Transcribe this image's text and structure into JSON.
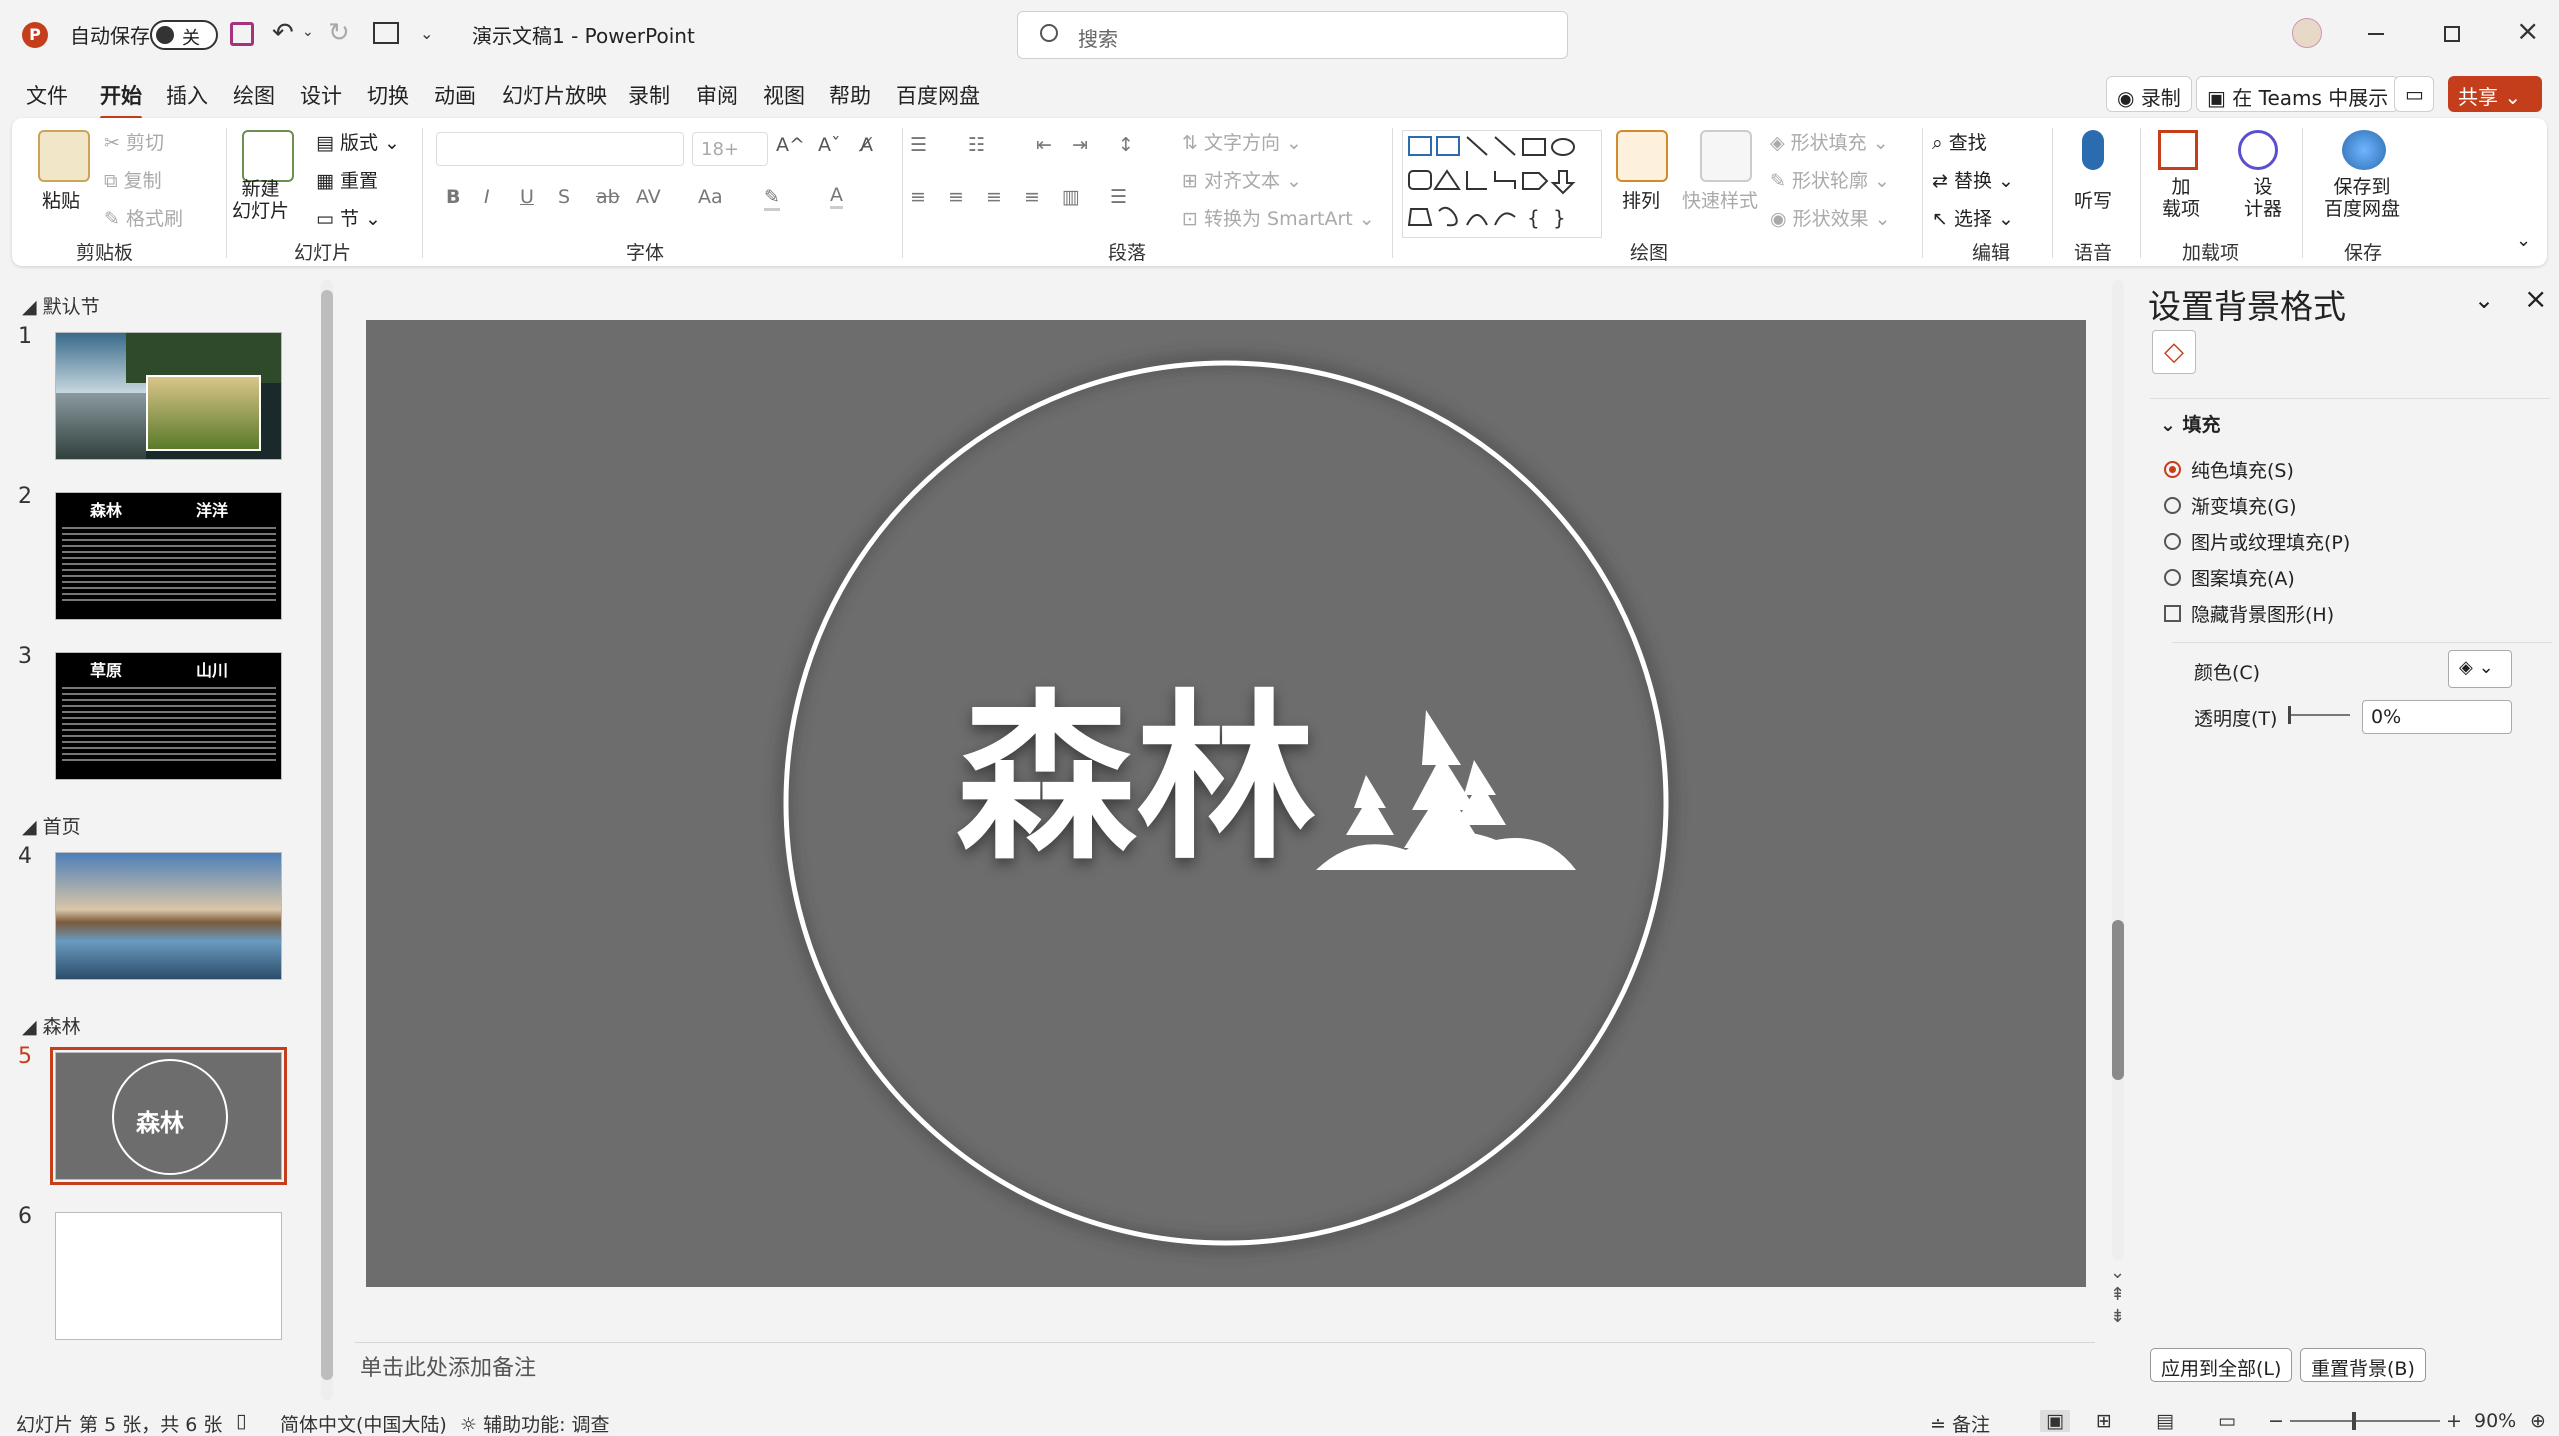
{
  "titlebar": {
    "autosave_label": "自动保存",
    "autosave_state": "关",
    "doc_title": "演示文稿1  -  PowerPoint",
    "search_placeholder": "搜索"
  },
  "tabs": [
    "文件",
    "开始",
    "插入",
    "绘图",
    "设计",
    "切换",
    "动画",
    "幻灯片放映",
    "录制",
    "审阅",
    "视图",
    "帮助",
    "百度网盘"
  ],
  "active_tab": "开始",
  "ribbon_right": {
    "record": "录制",
    "teams": "在 Teams 中展示",
    "share": "共享"
  },
  "groups": {
    "clipboard": {
      "label": "剪贴板",
      "paste": "粘贴",
      "cut": "剪切",
      "copy": "复制",
      "format_painter": "格式刷"
    },
    "slides": {
      "label": "幻灯片",
      "new_slide": "新建\n幻灯片",
      "layout": "版式",
      "reset": "重置",
      "section": "节"
    },
    "font": {
      "label": "字体",
      "font_size": "18+"
    },
    "paragraph": {
      "label": "段落",
      "text_direction": "文字方向",
      "align_text": "对齐文本",
      "smartart": "转换为 SmartArt"
    },
    "drawing": {
      "label": "绘图",
      "arrange": "排列",
      "quick_styles": "快速样式",
      "shape_fill": "形状填充",
      "shape_outline": "形状轮廓",
      "shape_effects": "形状效果"
    },
    "editing": {
      "label": "编辑",
      "find": "查找",
      "replace": "替换",
      "select": "选择"
    },
    "voice": {
      "label": "语音",
      "dictate": "听写"
    },
    "addins": {
      "label": "加载项",
      "addins": "加\n载项",
      "designer": "设\n计器"
    },
    "save": {
      "label": "保存",
      "save_baidu": "保存到\n百度网盘"
    }
  },
  "thumbnails": {
    "sections": [
      "默认节",
      "首页",
      "森林"
    ],
    "slides": [
      {
        "n": "1",
        "type": "photos"
      },
      {
        "n": "2",
        "type": "text",
        "left": "森林",
        "right": "洋洋"
      },
      {
        "n": "3",
        "type": "text",
        "left": "草原",
        "right": "山川"
      },
      {
        "n": "4",
        "type": "landscape"
      },
      {
        "n": "5",
        "type": "circle",
        "title": "森林",
        "selected": true
      },
      {
        "n": "6",
        "type": "blank"
      }
    ]
  },
  "slide": {
    "title": "森林",
    "bg_color": "#6d6d6d"
  },
  "notes_placeholder": "单击此处添加备注",
  "format_pane": {
    "title": "设置背景格式",
    "section": "填充",
    "options": [
      {
        "label": "纯色填充(S)",
        "selected": true
      },
      {
        "label": "渐变填充(G)",
        "selected": false
      },
      {
        "label": "图片或纹理填充(P)",
        "selected": false
      },
      {
        "label": "图案填充(A)",
        "selected": false
      }
    ],
    "hide_bg_graphics": "隐藏背景图形(H)",
    "color_label": "颜色(C)",
    "transparency_label": "透明度(T)",
    "transparency_value": "0%",
    "apply_all": "应用到全部(L)",
    "reset_bg": "重置背景(B)"
  },
  "status": {
    "slide_info": "幻灯片 第 5 张，共 6 张",
    "language": "简体中文(中国大陆)",
    "accessibility": "辅助功能: 调查",
    "notes": "备注",
    "zoom": "90%"
  },
  "colors": {
    "accent": "#c43e1c",
    "slide_bg": "#6d6d6d"
  }
}
